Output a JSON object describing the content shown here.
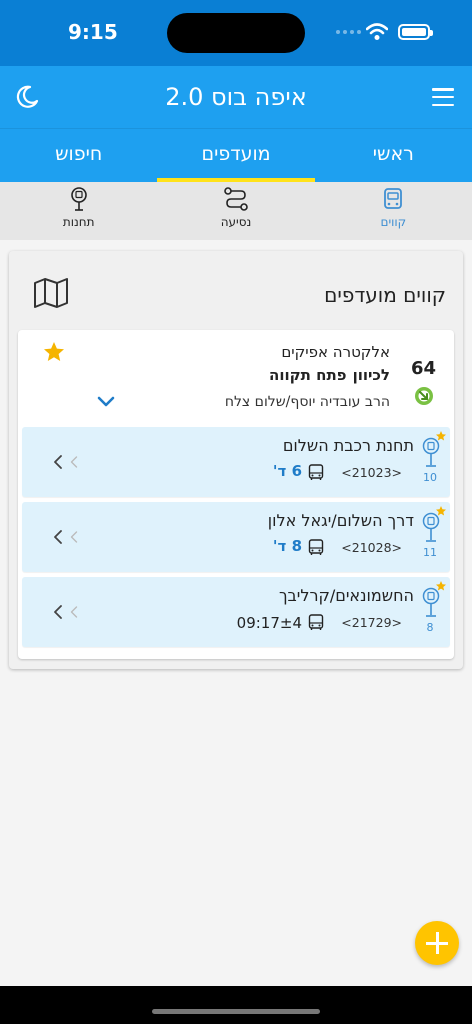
{
  "status": {
    "time": "9:15"
  },
  "app": {
    "title": "איפה בוס 2.0"
  },
  "tabs": [
    {
      "label": "ראשי"
    },
    {
      "label": "מועדפים"
    },
    {
      "label": "חיפוש"
    }
  ],
  "subtabs": [
    {
      "label": "קווים"
    },
    {
      "label": "נסיעה"
    },
    {
      "label": "תחנות"
    }
  ],
  "favorites": {
    "title": "קווים מועדפים",
    "line": {
      "number": "64",
      "operator": "אלקטרה אפיקים",
      "direction_prefix": "לכיוון",
      "destination": "פתח תקווה",
      "route": "הרב עובדיה יוסף/שלום צלח"
    },
    "stops": [
      {
        "name": "תחנת רכבת השלום",
        "code": "<21023>",
        "seq": "10",
        "eta": "6 ד'"
      },
      {
        "name": "דרך השלום/יגאל אלון",
        "code": "<21028>",
        "seq": "11",
        "eta": "8 ד'"
      },
      {
        "name": "החשמונאים/קרליבך",
        "code": "<21729>",
        "seq": "8",
        "time": "09:17±4"
      }
    ]
  },
  "colors": {
    "primary": "#1ea0f0",
    "status_bar": "#0a7fd4",
    "tab_indicator": "#ffe21a",
    "star": "#f5b400",
    "accent_blue": "#3f8fd2",
    "fab": "#ffc400"
  }
}
